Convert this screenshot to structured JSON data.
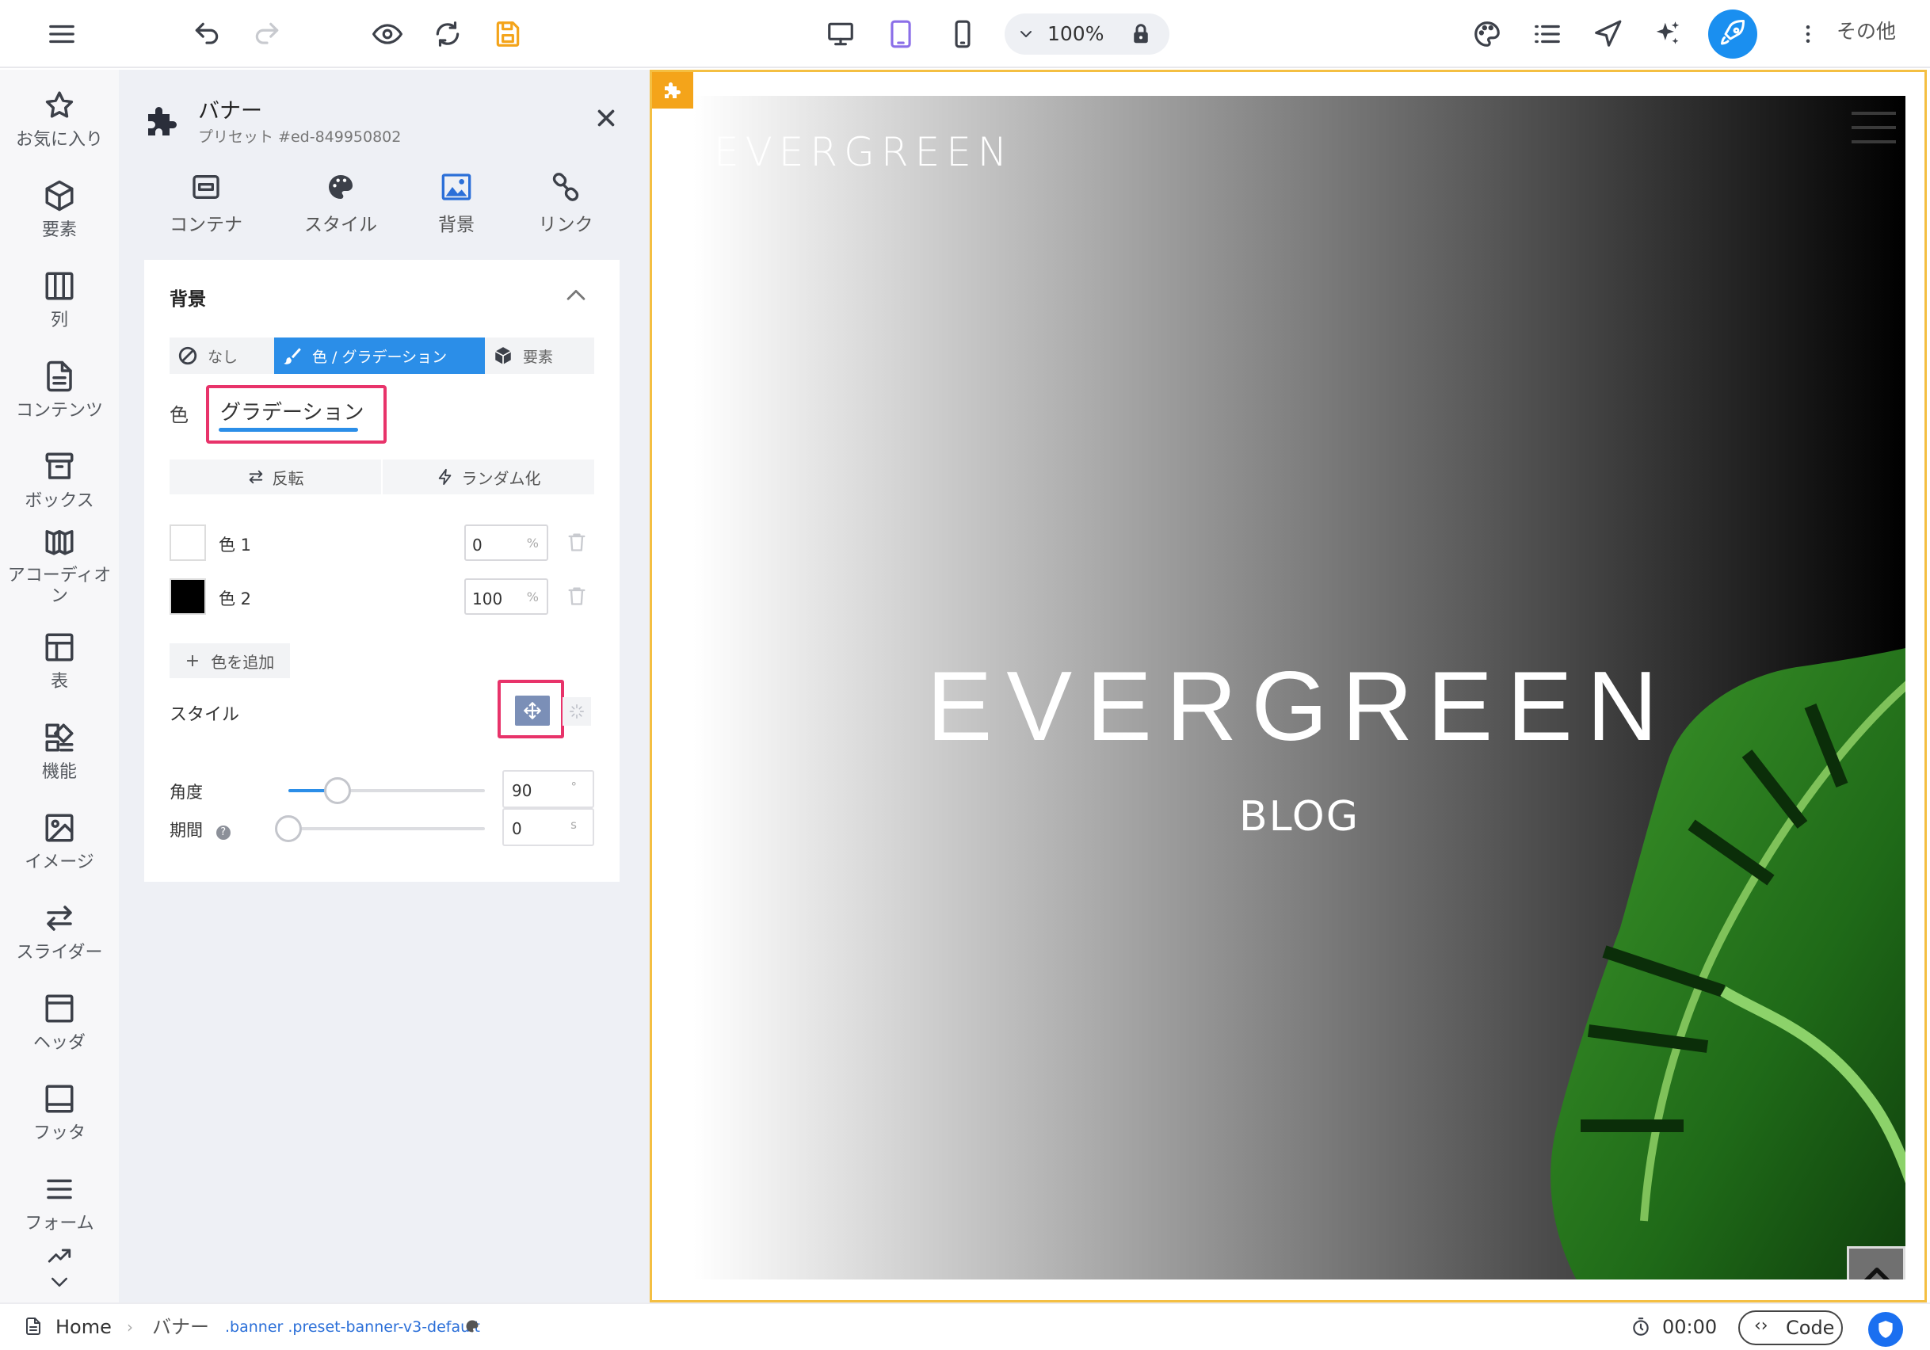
{
  "toolbar": {
    "zoom": "100%",
    "more_label": "その他",
    "accent": "#1a8ff0",
    "save_color": "#f4a41a",
    "active_device_color": "#8b6fe8"
  },
  "rail": {
    "items": [
      {
        "label": "お気に入り",
        "icon": "star-icon"
      },
      {
        "label": "要素",
        "icon": "cube-icon"
      },
      {
        "label": "列",
        "icon": "columns-icon"
      },
      {
        "label": "コンテンツ",
        "icon": "document-icon"
      },
      {
        "label": "ボックス",
        "icon": "box-icon"
      },
      {
        "label": "アコーディオン",
        "icon": "accordion-icon"
      },
      {
        "label": "表",
        "icon": "table-icon"
      },
      {
        "label": "機能",
        "icon": "features-icon"
      },
      {
        "label": "イメージ",
        "icon": "image-icon"
      },
      {
        "label": "スライダー",
        "icon": "slider-icon"
      },
      {
        "label": "ヘッダ",
        "icon": "header-icon"
      },
      {
        "label": "フッタ",
        "icon": "footer-icon"
      },
      {
        "label": "フォーム",
        "icon": "form-icon"
      }
    ]
  },
  "panel": {
    "title": "バナー",
    "subtitle": "プリセット #ed-849950802",
    "tabs": [
      {
        "label": "コンテナ"
      },
      {
        "label": "スタイル"
      },
      {
        "label": "背景"
      },
      {
        "label": "リンク"
      }
    ],
    "section_title": "背景",
    "bg_types": [
      {
        "label": "なし"
      },
      {
        "label": "色 / グラデーション"
      },
      {
        "label": "要素"
      }
    ],
    "color_label": "色",
    "color_tab": "グラデーション",
    "reverse_label": "反転",
    "random_label": "ランダム化",
    "colors": [
      {
        "label": "色 1",
        "value": "0",
        "unit": "%",
        "swatch": "#ffffff"
      },
      {
        "label": "色 2",
        "value": "100",
        "unit": "%",
        "swatch": "#000000"
      }
    ],
    "add_color": "色を追加",
    "style_label": "スタイル",
    "angle": {
      "label": "角度",
      "value": "90",
      "unit": "°",
      "fraction": 0.25
    },
    "duration": {
      "label": "期間",
      "value": "0",
      "unit": "s",
      "fraction": 0
    }
  },
  "canvas": {
    "logo_small": "EVERGREEN",
    "hero_title": "EVERGREEN",
    "hero_subtitle": "BLOG",
    "frame_color": "#f4bf42"
  },
  "statusbar": {
    "home": "Home",
    "element": "バナー",
    "classes": ".banner .preset-banner-v3-default",
    "timer": "00:00",
    "code_label": "Code"
  }
}
